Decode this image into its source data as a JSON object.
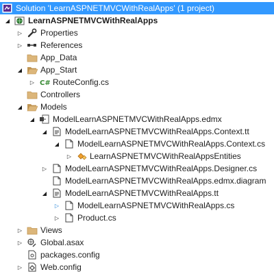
{
  "tree": [
    {
      "label": "Solution 'LearnASPNETMVCWithRealApps' (1 project)",
      "icon": "solution-icon",
      "toggle": "none",
      "indent": 0,
      "selected": true,
      "bold": false
    },
    {
      "label": "LearnASPNETMVCWithRealApps",
      "icon": "web-project-icon",
      "toggle": "open",
      "indent": 1,
      "selected": false,
      "bold": true
    },
    {
      "label": "Properties",
      "icon": "wrench-icon",
      "toggle": "closed",
      "indent": 2,
      "selected": false,
      "bold": false
    },
    {
      "label": "References",
      "icon": "references-icon",
      "toggle": "closed",
      "indent": 2,
      "selected": false,
      "bold": false
    },
    {
      "label": "App_Data",
      "icon": "folder-icon",
      "toggle": "none",
      "indent": 2,
      "selected": false,
      "bold": false
    },
    {
      "label": "App_Start",
      "icon": "folder-open-icon",
      "toggle": "open",
      "indent": 2,
      "selected": false,
      "bold": false
    },
    {
      "label": "RouteConfig.cs",
      "icon": "csharp-file-icon",
      "toggle": "closed",
      "indent": 3,
      "selected": false,
      "bold": false
    },
    {
      "label": "Controllers",
      "icon": "folder-icon",
      "toggle": "none",
      "indent": 2,
      "selected": false,
      "bold": false
    },
    {
      "label": "Models",
      "icon": "folder-open-icon",
      "toggle": "open",
      "indent": 2,
      "selected": false,
      "bold": false
    },
    {
      "label": "ModelLearnASPNETMVCWithRealApps.edmx",
      "icon": "edmx-file-icon",
      "toggle": "open",
      "indent": 3,
      "selected": false,
      "bold": false
    },
    {
      "label": "ModelLearnASPNETMVCWithRealApps.Context.tt",
      "icon": "tt-file-icon",
      "toggle": "open",
      "indent": 4,
      "selected": false,
      "bold": false
    },
    {
      "label": "ModelLearnASPNETMVCWithRealApps.Context.cs",
      "icon": "document-icon",
      "toggle": "open",
      "indent": 5,
      "selected": false,
      "bold": false
    },
    {
      "label": "LearnASPNETMVCWithRealAppsEntities",
      "icon": "class-icon",
      "toggle": "closed",
      "indent": 6,
      "selected": false,
      "bold": false
    },
    {
      "label": "ModelLearnASPNETMVCWithRealApps.Designer.cs",
      "icon": "document-icon",
      "toggle": "closed",
      "indent": 4,
      "selected": false,
      "bold": false
    },
    {
      "label": "ModelLearnASPNETMVCWithRealApps.edmx.diagram",
      "icon": "document-icon",
      "toggle": "none",
      "indent": 4,
      "selected": false,
      "bold": false
    },
    {
      "label": "ModelLearnASPNETMVCWithRealApps.tt",
      "icon": "tt-file-icon",
      "toggle": "open",
      "indent": 4,
      "selected": false,
      "bold": false
    },
    {
      "label": "ModelLearnASPNETMVCWithRealApps.cs",
      "icon": "document-icon",
      "toggle": "closed-blue",
      "indent": 5,
      "selected": false,
      "bold": false
    },
    {
      "label": "Product.cs",
      "icon": "document-icon",
      "toggle": "closed",
      "indent": 5,
      "selected": false,
      "bold": false
    },
    {
      "label": "Views",
      "icon": "folder-icon",
      "toggle": "closed",
      "indent": 2,
      "selected": false,
      "bold": false
    },
    {
      "label": "Global.asax",
      "icon": "global-asax-icon",
      "toggle": "closed",
      "indent": 2,
      "selected": false,
      "bold": false
    },
    {
      "label": "packages.config",
      "icon": "config-file-icon",
      "toggle": "none",
      "indent": 2,
      "selected": false,
      "bold": false
    },
    {
      "label": "Web.config",
      "icon": "web-config-icon",
      "toggle": "closed",
      "indent": 2,
      "selected": false,
      "bold": false
    }
  ]
}
